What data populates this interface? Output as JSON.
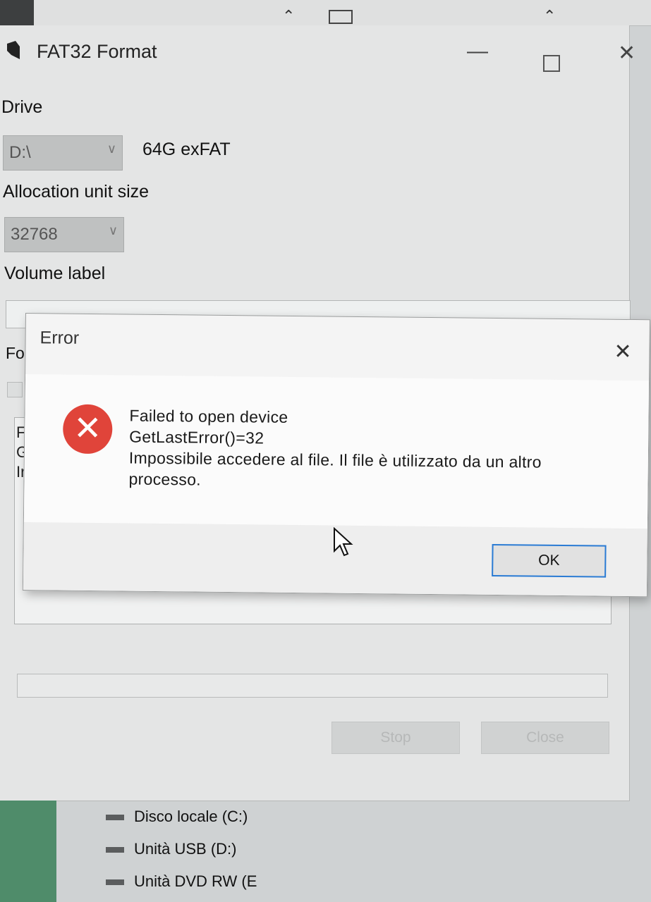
{
  "app_window": {
    "title": "FAT32 Format",
    "controls": {
      "minimize": "—",
      "maximize": "",
      "close": "✕"
    }
  },
  "form": {
    "drive_label": "Drive",
    "drive_value": "D:\\",
    "drive_info": "64G exFAT",
    "allocation_label": "Allocation unit size",
    "allocation_value": "32768",
    "volume_label_label": "Volume label",
    "volume_label_value": "",
    "format_options_label_partial": "Fo",
    "log_lines_partial": [
      "F",
      "G",
      "Ir"
    ],
    "stop_button": "Stop",
    "close_button": "Close"
  },
  "error_dialog": {
    "title": "Error",
    "close_glyph": "✕",
    "icon_glyph": "✕",
    "messages": [
      "Failed to open device",
      "GetLastError()=32",
      "Impossibile accedere al file. Il file è utilizzato da un altro",
      "processo."
    ],
    "ok_button": "OK"
  },
  "explorer": {
    "drives": [
      {
        "label": "Disco locale (C:)",
        "icon": "hard-drive-icon"
      },
      {
        "label": "Unità USB (D:)",
        "icon": "usb-drive-icon"
      },
      {
        "label": "Unità DVD RW (E",
        "icon": "dvd-drive-icon"
      }
    ]
  },
  "colors": {
    "error_red": "#e0443a",
    "focus_blue": "#2a7bd4"
  }
}
